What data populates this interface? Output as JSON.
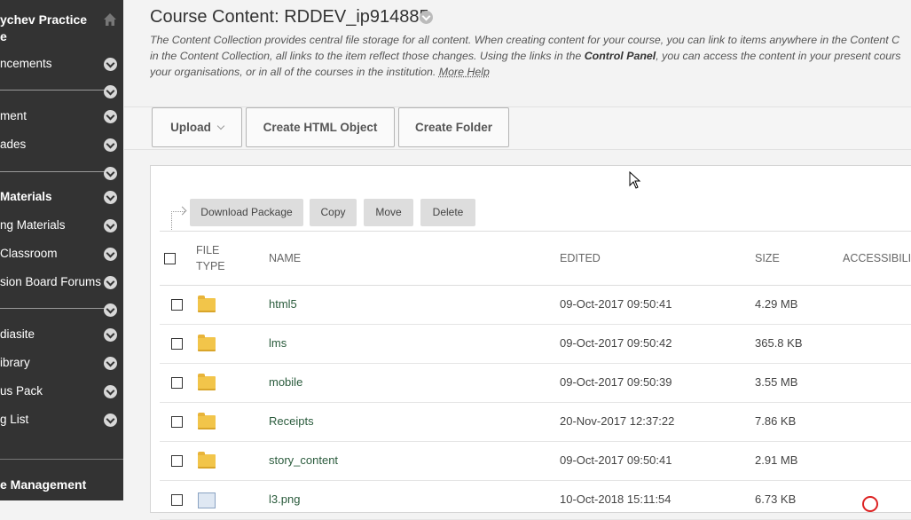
{
  "sidebar": {
    "title_lines": [
      "ychev Practice",
      "e"
    ],
    "items": [
      {
        "label": "ncements",
        "bold": false
      },
      {
        "label": "",
        "bold": false
      },
      {
        "label": "ment",
        "bold": false
      },
      {
        "label": "ades",
        "bold": false
      },
      {
        "label": "",
        "bold": false
      },
      {
        "label": "Materials",
        "bold": true
      },
      {
        "label": "ng Materials",
        "bold": false
      },
      {
        "label": "Classroom",
        "bold": false
      },
      {
        "label": "sion Board Forums",
        "bold": false
      },
      {
        "label": "",
        "bold": false
      },
      {
        "label": "diasite",
        "bold": false
      },
      {
        "label": "ibrary",
        "bold": false
      },
      {
        "label": "us Pack",
        "bold": false
      },
      {
        "label": "g List",
        "bold": false
      }
    ],
    "footer": "e Management"
  },
  "header": {
    "title": "Course Content: RDDEV_ip914885",
    "desc_line1": "The Content Collection provides central file storage for all content. When creating content for your course, you can link to items anywhere in the Content C",
    "desc_line2_pre": "in the Content Collection, all links to the item reflect those changes. Using the links in the ",
    "desc_line2_bold": "Control Panel",
    "desc_line2_post": ", you can access the content in your present cours",
    "desc_line3_pre": "your organisations, or in all of the courses in the institution. ",
    "more_help": "More Help"
  },
  "toolbar": {
    "upload": "Upload",
    "create_html": "Create HTML Object",
    "create_folder": "Create Folder"
  },
  "actions": {
    "download": "Download Package",
    "copy": "Copy",
    "move": "Move",
    "delete": "Delete"
  },
  "table": {
    "headers": {
      "file_type_1": "FILE",
      "file_type_2": "TYPE",
      "name": "NAME",
      "edited": "EDITED",
      "size": "SIZE",
      "accessibility": "ACCESSIBILIT"
    },
    "rows": [
      {
        "type": "folder",
        "name": "html5",
        "edited": "09-Oct-2017 09:50:41",
        "size": "4.29 MB"
      },
      {
        "type": "folder",
        "name": "lms",
        "edited": "09-Oct-2017 09:50:42",
        "size": "365.8 KB"
      },
      {
        "type": "folder",
        "name": "mobile",
        "edited": "09-Oct-2017 09:50:39",
        "size": "3.55 MB"
      },
      {
        "type": "folder",
        "name": "Receipts",
        "edited": "20-Nov-2017 12:37:22",
        "size": "7.86 KB"
      },
      {
        "type": "folder",
        "name": "story_content",
        "edited": "09-Oct-2017 09:50:41",
        "size": "2.91 MB"
      },
      {
        "type": "image",
        "name": "l3.png",
        "edited": "10-Oct-2018 15:11:54",
        "size": "6.73 KB"
      }
    ]
  }
}
